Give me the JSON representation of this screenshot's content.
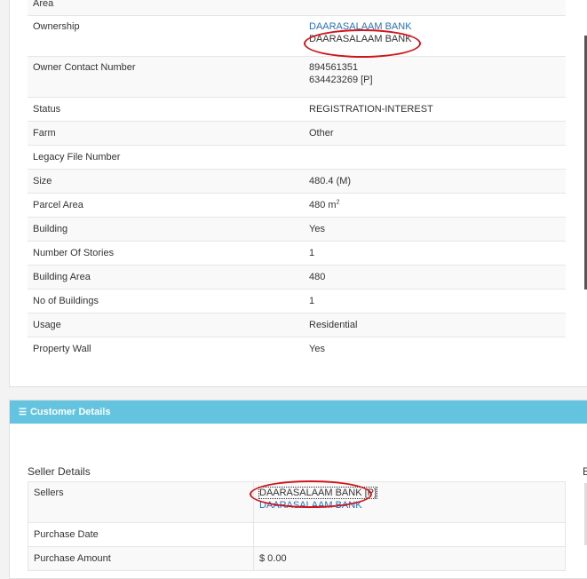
{
  "property": {
    "rows": [
      {
        "label": "Area",
        "value": ""
      },
      {
        "label": "Ownership",
        "value_link": "DAARASALAAM BANK",
        "value": "DAARASALAAM BANK"
      },
      {
        "label": "Owner Contact Number",
        "value": "894561351",
        "value2": "634423269 [P]"
      },
      {
        "label": "Status",
        "value": "REGISTRATION-INTEREST"
      },
      {
        "label": "Farm",
        "value": "Other"
      },
      {
        "label": "Legacy File Number",
        "value": ""
      },
      {
        "label": "Size",
        "value": "480.4 (M)"
      },
      {
        "label": "Parcel Area",
        "value": "480 m",
        "unit_sup": "2"
      },
      {
        "label": "Building",
        "value": "Yes"
      },
      {
        "label": "Number Of Stories",
        "value": "1"
      },
      {
        "label": "Building Area",
        "value": "480"
      },
      {
        "label": "No of Buildings",
        "value": "1"
      },
      {
        "label": "Usage",
        "value": "Residential"
      },
      {
        "label": "Property Wall",
        "value": "Yes"
      }
    ]
  },
  "customer": {
    "header": "Customer Details",
    "icon": "list-icon",
    "seller_title": "Seller Details",
    "right_edge_text": "B",
    "rows": [
      {
        "label": "Sellers",
        "value": "DAARASALAAM BANK [P]",
        "value2": "DAARASALAAM BANK"
      },
      {
        "label": "Purchase Date",
        "value": ""
      },
      {
        "label": "Purchase Amount",
        "value": "$ 0.00"
      }
    ]
  },
  "colors": {
    "header_bg": "#64c4df",
    "link": "#2a6fb5",
    "annotation": "#d0141a"
  }
}
